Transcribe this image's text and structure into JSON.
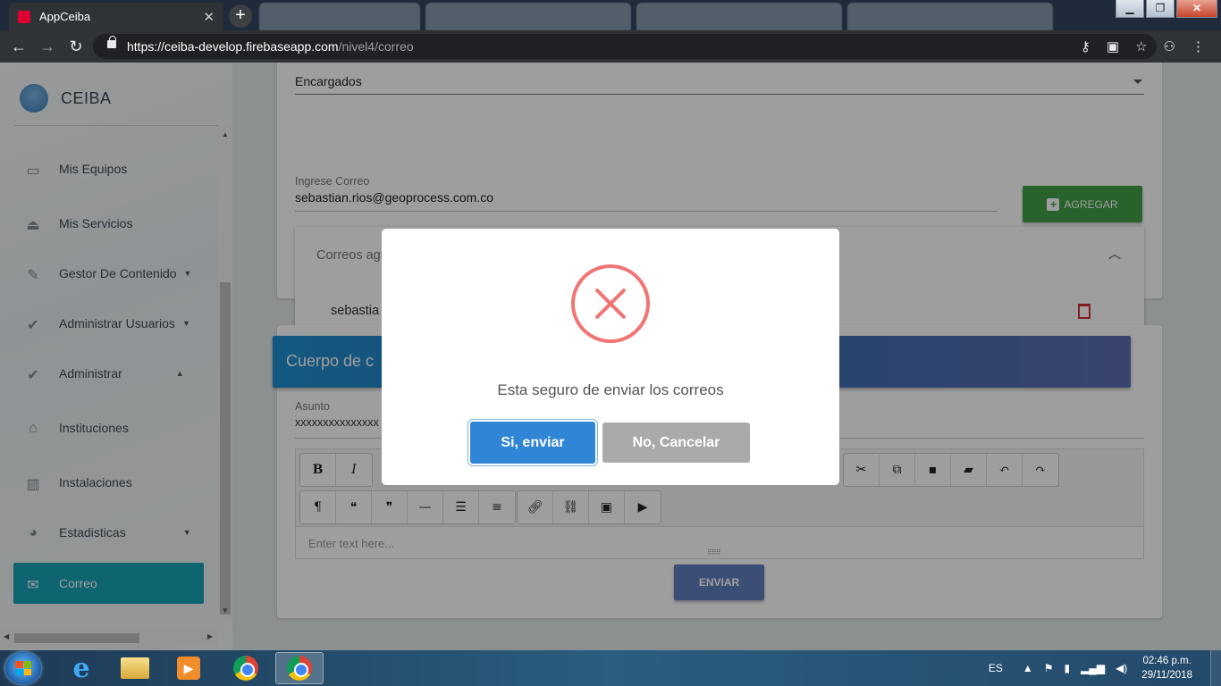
{
  "browser": {
    "active_tab_title": "AppCeiba",
    "new_tab_symbol": "+",
    "url_host": "https://ceiba-develop.firebaseapp.com",
    "url_path": "/nivel4/correo"
  },
  "sidebar": {
    "brand": "CEIBA",
    "items": [
      {
        "label": "Mis Equipos",
        "icon": "laptop-icon"
      },
      {
        "label": "Mis Servicios",
        "icon": "eject-icon"
      },
      {
        "label": "Gestor De Contenido",
        "icon": "pencil-icon",
        "caret": "down"
      },
      {
        "label": "Administrar Usuarios",
        "icon": "user-check-icon",
        "caret": "down"
      },
      {
        "label": "Administrar",
        "icon": "user-check-icon",
        "caret": "up"
      },
      {
        "label": "Instituciones",
        "icon": "bank-icon"
      },
      {
        "label": "Instalaciones",
        "icon": "building-icon"
      },
      {
        "label": "Estadisticas",
        "icon": "pie-chart-icon",
        "caret": "down"
      },
      {
        "label": "Correo",
        "icon": "mail-icon",
        "active": true
      }
    ]
  },
  "form": {
    "select_value": "Encargados",
    "email_label": "Ingrese Correo",
    "email_value": "sebastian.rios@geoprocess.com.co",
    "add_button": "AGREGAR",
    "added_panel_title": "Correos agregados",
    "added_email_visible": "sebastia"
  },
  "body_section": {
    "header_visible": "Cuerpo de c",
    "subject_label": "Asunto",
    "subject_value_visible": "xxxxxxxxxxxxxxx",
    "editor_placeholder": "Enter text here...",
    "send_button": "ENVIAR"
  },
  "editor_toolbar": {
    "row1_left": [
      "B",
      "I"
    ],
    "row1_right": [
      "scissors-icon",
      "copy-icon",
      "trash-icon",
      "eraser-icon",
      "undo-icon",
      "redo-icon"
    ],
    "row2": [
      "pilcrow-icon",
      "blockquote-icon",
      "quote-close-icon",
      "hr-icon",
      "bullet-list-icon",
      "numbered-list-icon",
      "link-icon",
      "unlink-icon",
      "image-icon",
      "video-icon"
    ]
  },
  "modal": {
    "message": "Esta seguro de enviar los correos",
    "confirm_button": "Si, enviar",
    "cancel_button": "No, Cancelar"
  },
  "taskbar": {
    "language": "ES",
    "time": "02:46 p.m.",
    "date": "29/11/2018"
  },
  "colors": {
    "accent_active": "#17a2b3",
    "add_button": "#43a047",
    "confirm": "#3085d6",
    "error": "#f27474",
    "delete": "#d32f2f"
  }
}
